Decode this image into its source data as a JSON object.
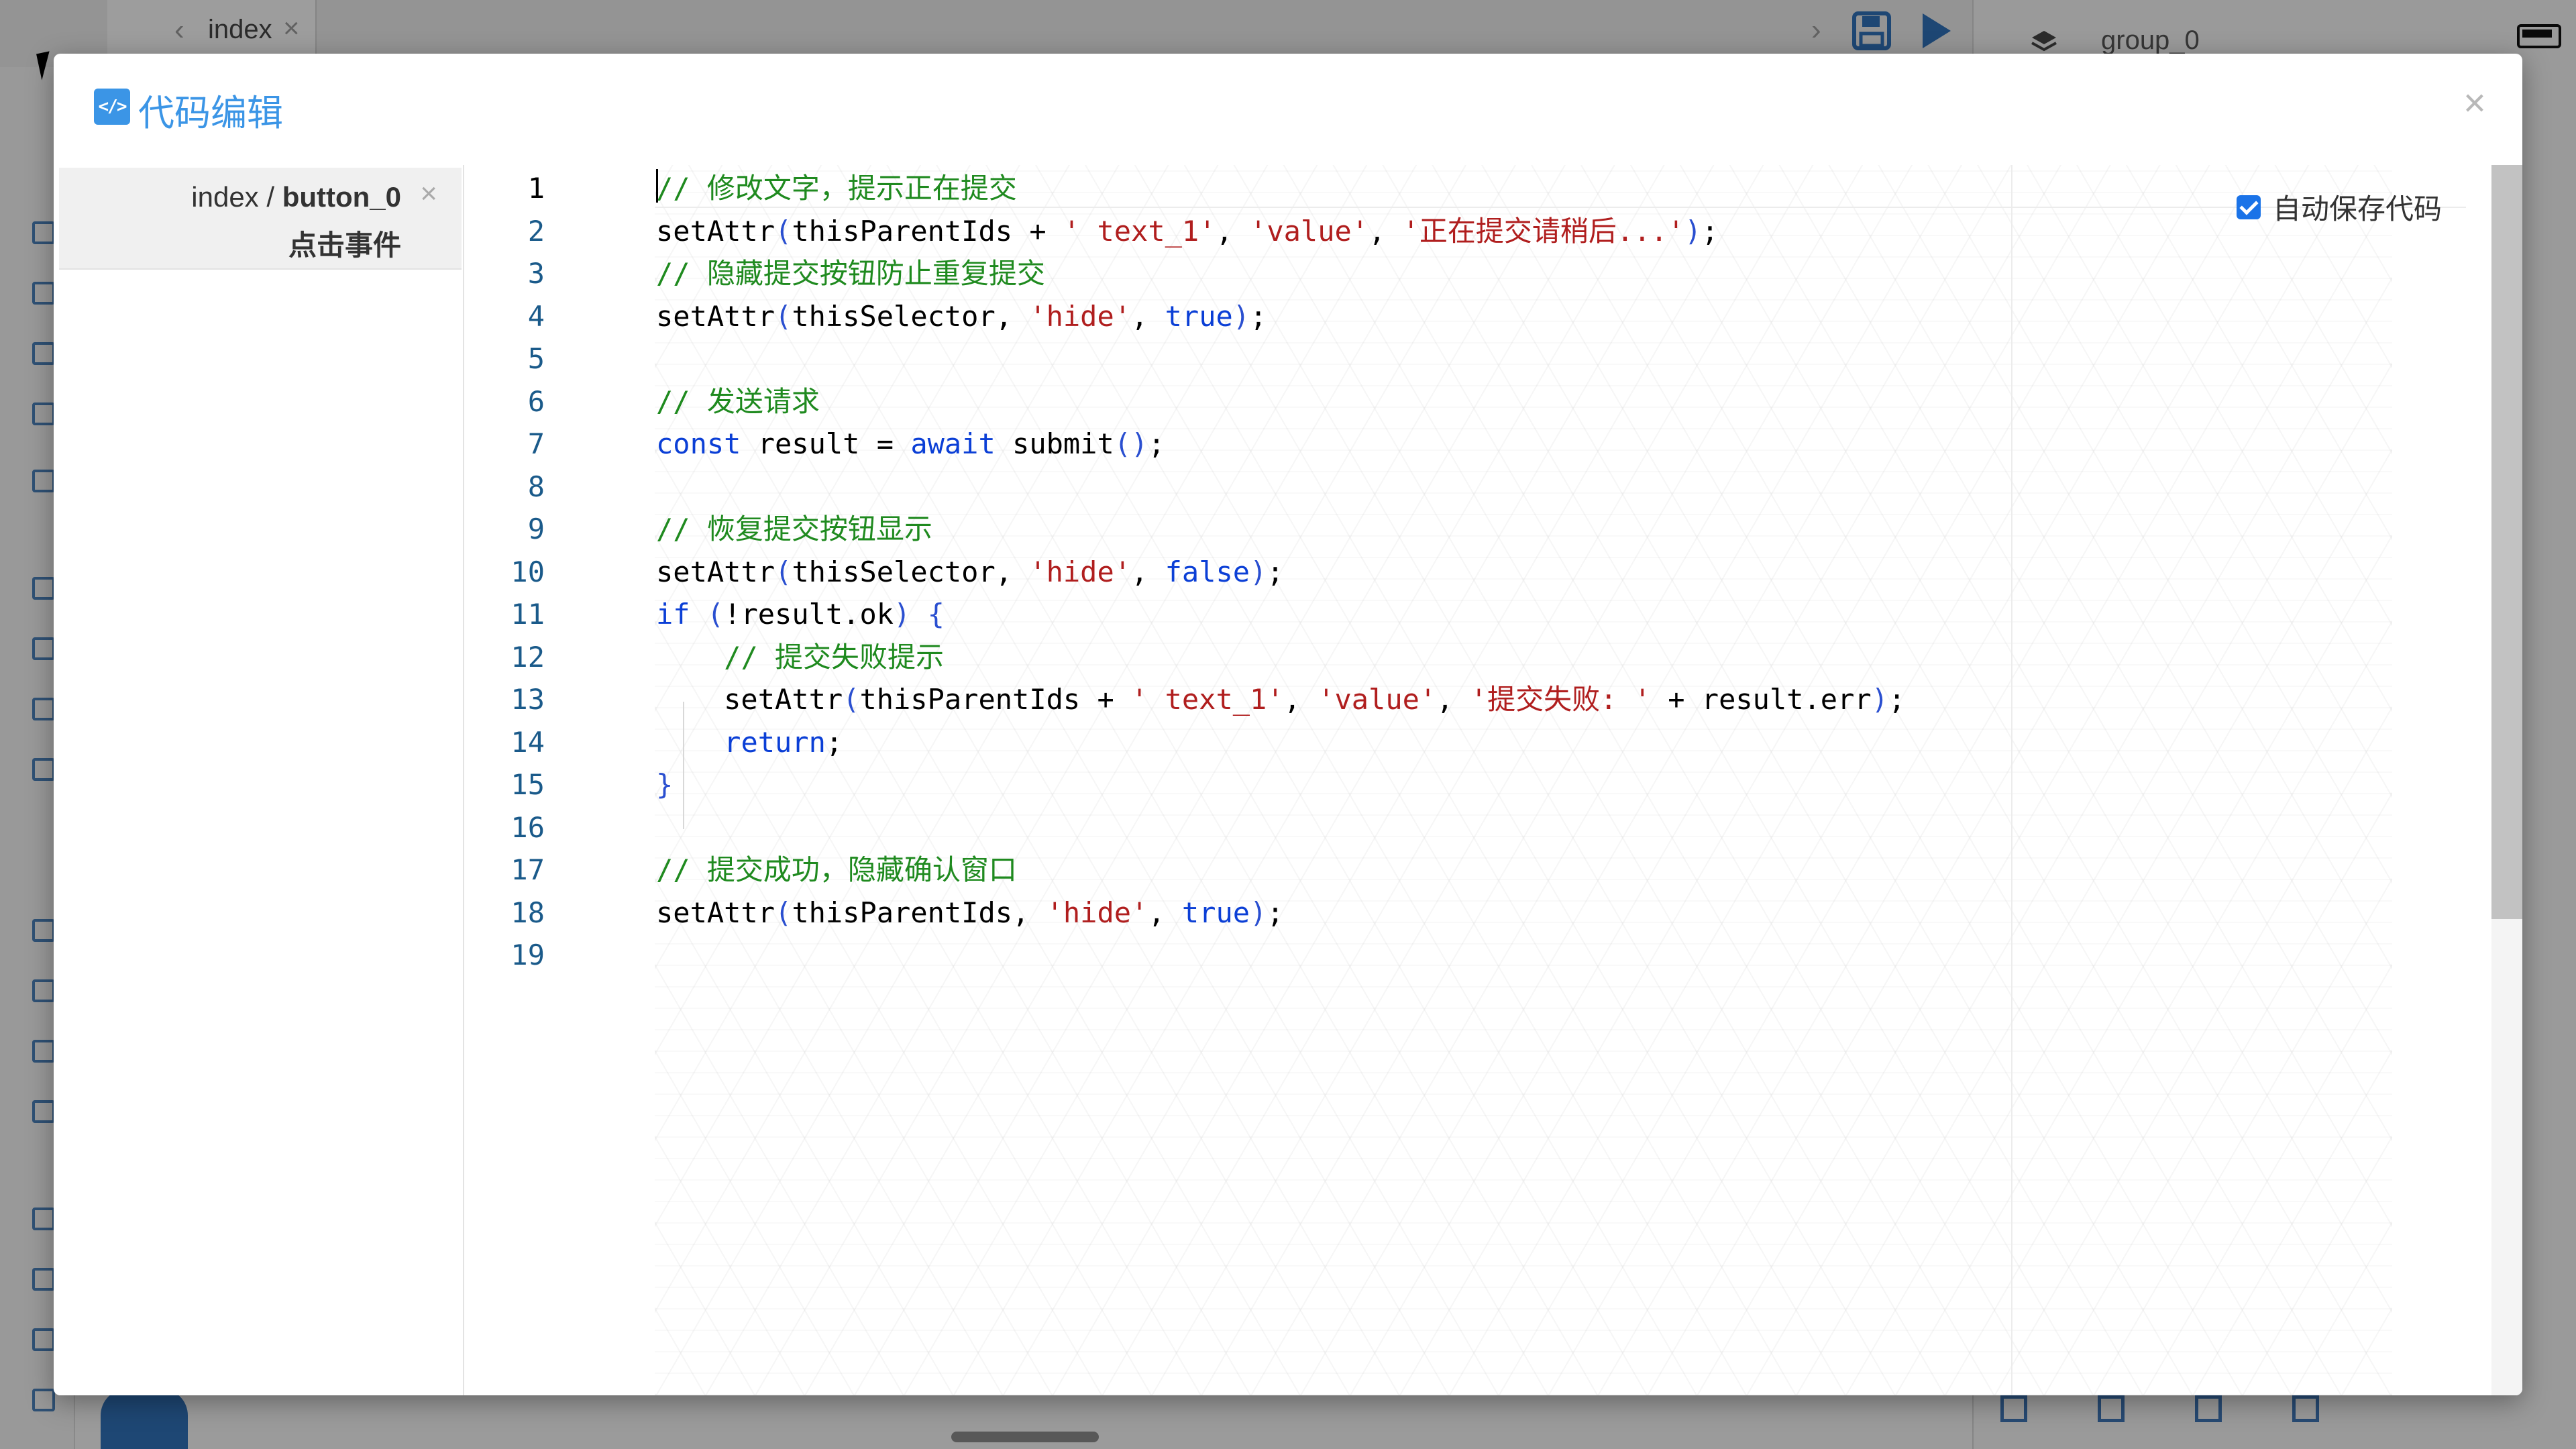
{
  "background": {
    "tab_label": "index",
    "group_label": "group_0"
  },
  "modal": {
    "title": "代码编辑",
    "title_icon": "code-icon",
    "close_symbol": "×",
    "colors": {
      "accent": "#3b95e6",
      "comment": "#1f8a1f",
      "string": "#b01e1e",
      "keyword": "#0b3fd6"
    }
  },
  "sidebar": {
    "path_prefix": "index / ",
    "path_component": "button_0",
    "event_label": "点击事件",
    "close_symbol": "×"
  },
  "autosave": {
    "label": "自动保存代码",
    "checked": true
  },
  "code_lines": [
    {
      "n": "1",
      "tokens": [
        [
          "cm",
          "// 修改文字，提示正在提交"
        ]
      ]
    },
    {
      "n": "2",
      "tokens": [
        [
          "",
          "setAttr"
        ],
        [
          "pn",
          "("
        ],
        [
          "",
          "thisParentIds + "
        ],
        [
          "st",
          "' text_1'"
        ],
        [
          "",
          ", "
        ],
        [
          "st",
          "'value'"
        ],
        [
          "",
          ", "
        ],
        [
          "st",
          "'正在提交请稍后...'"
        ],
        [
          "pn",
          ")"
        ],
        [
          "",
          ";"
        ]
      ]
    },
    {
      "n": "3",
      "tokens": [
        [
          "cm",
          "// 隐藏提交按钮防止重复提交"
        ]
      ]
    },
    {
      "n": "4",
      "tokens": [
        [
          "",
          "setAttr"
        ],
        [
          "pn",
          "("
        ],
        [
          "",
          "thisSelector, "
        ],
        [
          "st",
          "'hide'"
        ],
        [
          "",
          ", "
        ],
        [
          "kw",
          "true"
        ],
        [
          "pn",
          ")"
        ],
        [
          "",
          ";"
        ]
      ]
    },
    {
      "n": "5",
      "tokens": []
    },
    {
      "n": "6",
      "tokens": [
        [
          "cm",
          "// 发送请求"
        ]
      ]
    },
    {
      "n": "7",
      "tokens": [
        [
          "kw",
          "const"
        ],
        [
          "",
          " result = "
        ],
        [
          "kw",
          "await"
        ],
        [
          "",
          " submit"
        ],
        [
          "pn",
          "()"
        ],
        [
          "",
          ";"
        ]
      ]
    },
    {
      "n": "8",
      "tokens": []
    },
    {
      "n": "9",
      "tokens": [
        [
          "cm",
          "// 恢复提交按钮显示"
        ]
      ]
    },
    {
      "n": "10",
      "tokens": [
        [
          "",
          "setAttr"
        ],
        [
          "pn",
          "("
        ],
        [
          "",
          "thisSelector, "
        ],
        [
          "st",
          "'hide'"
        ],
        [
          "",
          ", "
        ],
        [
          "kw",
          "false"
        ],
        [
          "pn",
          ")"
        ],
        [
          "",
          ";"
        ]
      ]
    },
    {
      "n": "11",
      "tokens": [
        [
          "kw",
          "if"
        ],
        [
          "",
          " "
        ],
        [
          "pn",
          "("
        ],
        [
          "",
          "!result.ok"
        ],
        [
          "pn",
          ")"
        ],
        [
          "",
          " "
        ],
        [
          "pn",
          "{"
        ]
      ]
    },
    {
      "n": "12",
      "tokens": [
        [
          "",
          "    "
        ],
        [
          "cm",
          "// 提交失败提示"
        ]
      ]
    },
    {
      "n": "13",
      "tokens": [
        [
          "",
          "    setAttr"
        ],
        [
          "pn",
          "("
        ],
        [
          "",
          "thisParentIds + "
        ],
        [
          "st",
          "' text_1'"
        ],
        [
          "",
          ", "
        ],
        [
          "st",
          "'value'"
        ],
        [
          "",
          ", "
        ],
        [
          "st",
          "'提交失败: '"
        ],
        [
          "",
          " + result.err"
        ],
        [
          "pn",
          ")"
        ],
        [
          "",
          ";"
        ]
      ]
    },
    {
      "n": "14",
      "tokens": [
        [
          "",
          "    "
        ],
        [
          "kw",
          "return"
        ],
        [
          "",
          ";"
        ]
      ]
    },
    {
      "n": "15",
      "tokens": [
        [
          "pn",
          "}"
        ]
      ]
    },
    {
      "n": "16",
      "tokens": []
    },
    {
      "n": "17",
      "tokens": [
        [
          "cm",
          "// 提交成功，隐藏确认窗口"
        ]
      ]
    },
    {
      "n": "18",
      "tokens": [
        [
          "",
          "setAttr"
        ],
        [
          "pn",
          "("
        ],
        [
          "",
          "thisParentIds, "
        ],
        [
          "st",
          "'hide'"
        ],
        [
          "",
          ", "
        ],
        [
          "kw",
          "true"
        ],
        [
          "pn",
          ")"
        ],
        [
          "",
          ";"
        ]
      ]
    },
    {
      "n": "19",
      "tokens": []
    }
  ]
}
